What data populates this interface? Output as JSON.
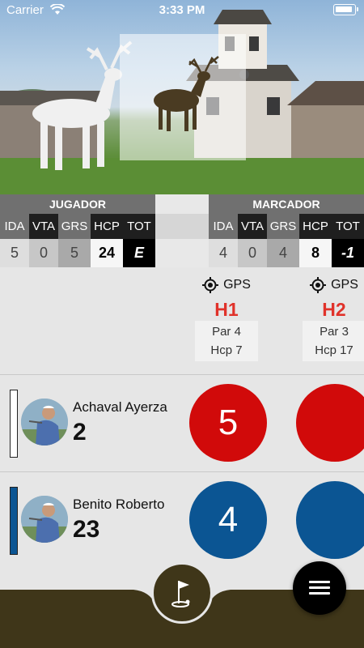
{
  "status_bar": {
    "carrier": "Carrier",
    "time": "3:33 PM"
  },
  "colors": {
    "red": "#d10a0a",
    "blue": "#0b5593",
    "hole_red": "#e0322a",
    "bottom_bar": "#3f3619"
  },
  "jugador": {
    "title": "JUGADOR",
    "headers": [
      "IDA",
      "VTA",
      "GRS",
      "HCP",
      "TOT"
    ],
    "values": [
      "5",
      "0",
      "5",
      "24",
      "E"
    ]
  },
  "marcador": {
    "title": "MARCADOR",
    "headers": [
      "IDA",
      "VTA",
      "GRS",
      "HCP",
      "TOT"
    ],
    "values": [
      "4",
      "0",
      "4",
      "8",
      "-1"
    ]
  },
  "holes": [
    {
      "gps_label": "GPS",
      "number": "H1",
      "par": "Par 4",
      "hcp": "Hcp 7"
    },
    {
      "gps_label": "GPS",
      "number": "H2",
      "par": "Par 3",
      "hcp": "Hcp 17"
    }
  ],
  "players": [
    {
      "name": "Achaval Ayerza",
      "hcp": "2",
      "scores": [
        "5",
        ""
      ],
      "color": "white"
    },
    {
      "name": "Benito Roberto",
      "hcp": "23",
      "scores": [
        "4",
        ""
      ],
      "color": "blue"
    }
  ],
  "icons": {
    "gps": "crosshair-icon",
    "wifi": "wifi-icon",
    "flag": "golf-flag-icon",
    "menu": "hamburger-menu-icon"
  }
}
